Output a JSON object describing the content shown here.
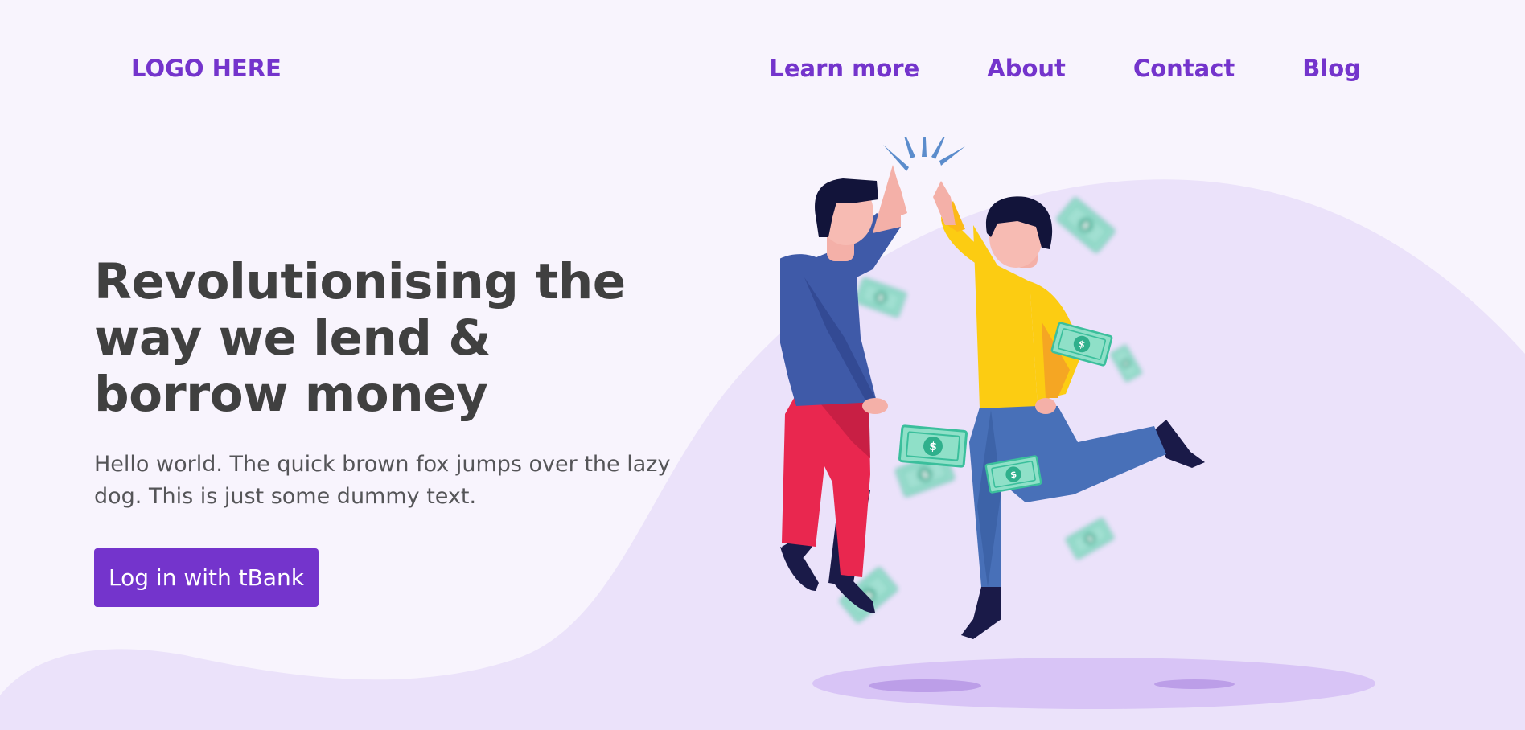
{
  "header": {
    "logo": "LOGO HERE",
    "nav": [
      "Learn more",
      "About",
      "Contact",
      "Blog"
    ]
  },
  "hero": {
    "title": "Revolutionising the way we lend & borrow money",
    "subtitle": "Hello world. The quick brown fox jumps over the lazy dog. This is just some dummy text.",
    "cta_label": "Log in with tBank"
  },
  "illustration": {
    "subject": "two people high-five with banknotes",
    "icon": "money-bill-icon"
  },
  "colors": {
    "background": "#f8f4fd",
    "blob": "#ebe2fa",
    "accent": "#7434cc",
    "heading": "#404040",
    "body_text": "#555558"
  }
}
